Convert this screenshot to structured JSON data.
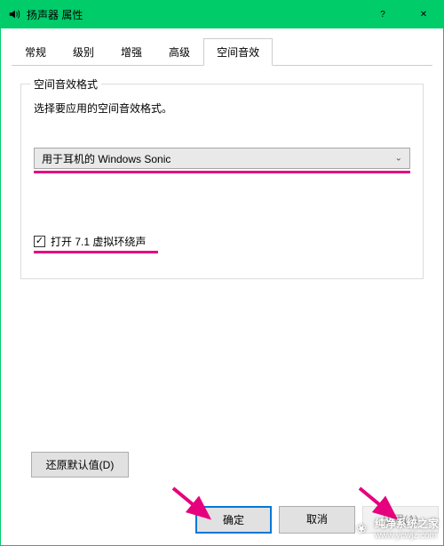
{
  "window": {
    "title": "扬声器 属性"
  },
  "tabs": {
    "items": [
      {
        "label": "常规"
      },
      {
        "label": "级别"
      },
      {
        "label": "增强"
      },
      {
        "label": "高级"
      },
      {
        "label": "空间音效"
      }
    ],
    "active_index": 4
  },
  "group": {
    "legend": "空间音效格式",
    "description": "选择要应用的空间音效格式。",
    "dropdown_value": "用于耳机的 Windows Sonic"
  },
  "checkbox": {
    "checked": true,
    "label": "打开 7.1 虚拟环绕声"
  },
  "buttons": {
    "restore": "还原默认值(D)",
    "ok": "确定",
    "cancel": "取消",
    "apply": "应用(A)"
  },
  "watermark": {
    "line1": "纯净系统之家",
    "line2": "www.ycwjz.com"
  },
  "colors": {
    "accent": "#00cc6a",
    "highlight": "#e6007e"
  }
}
